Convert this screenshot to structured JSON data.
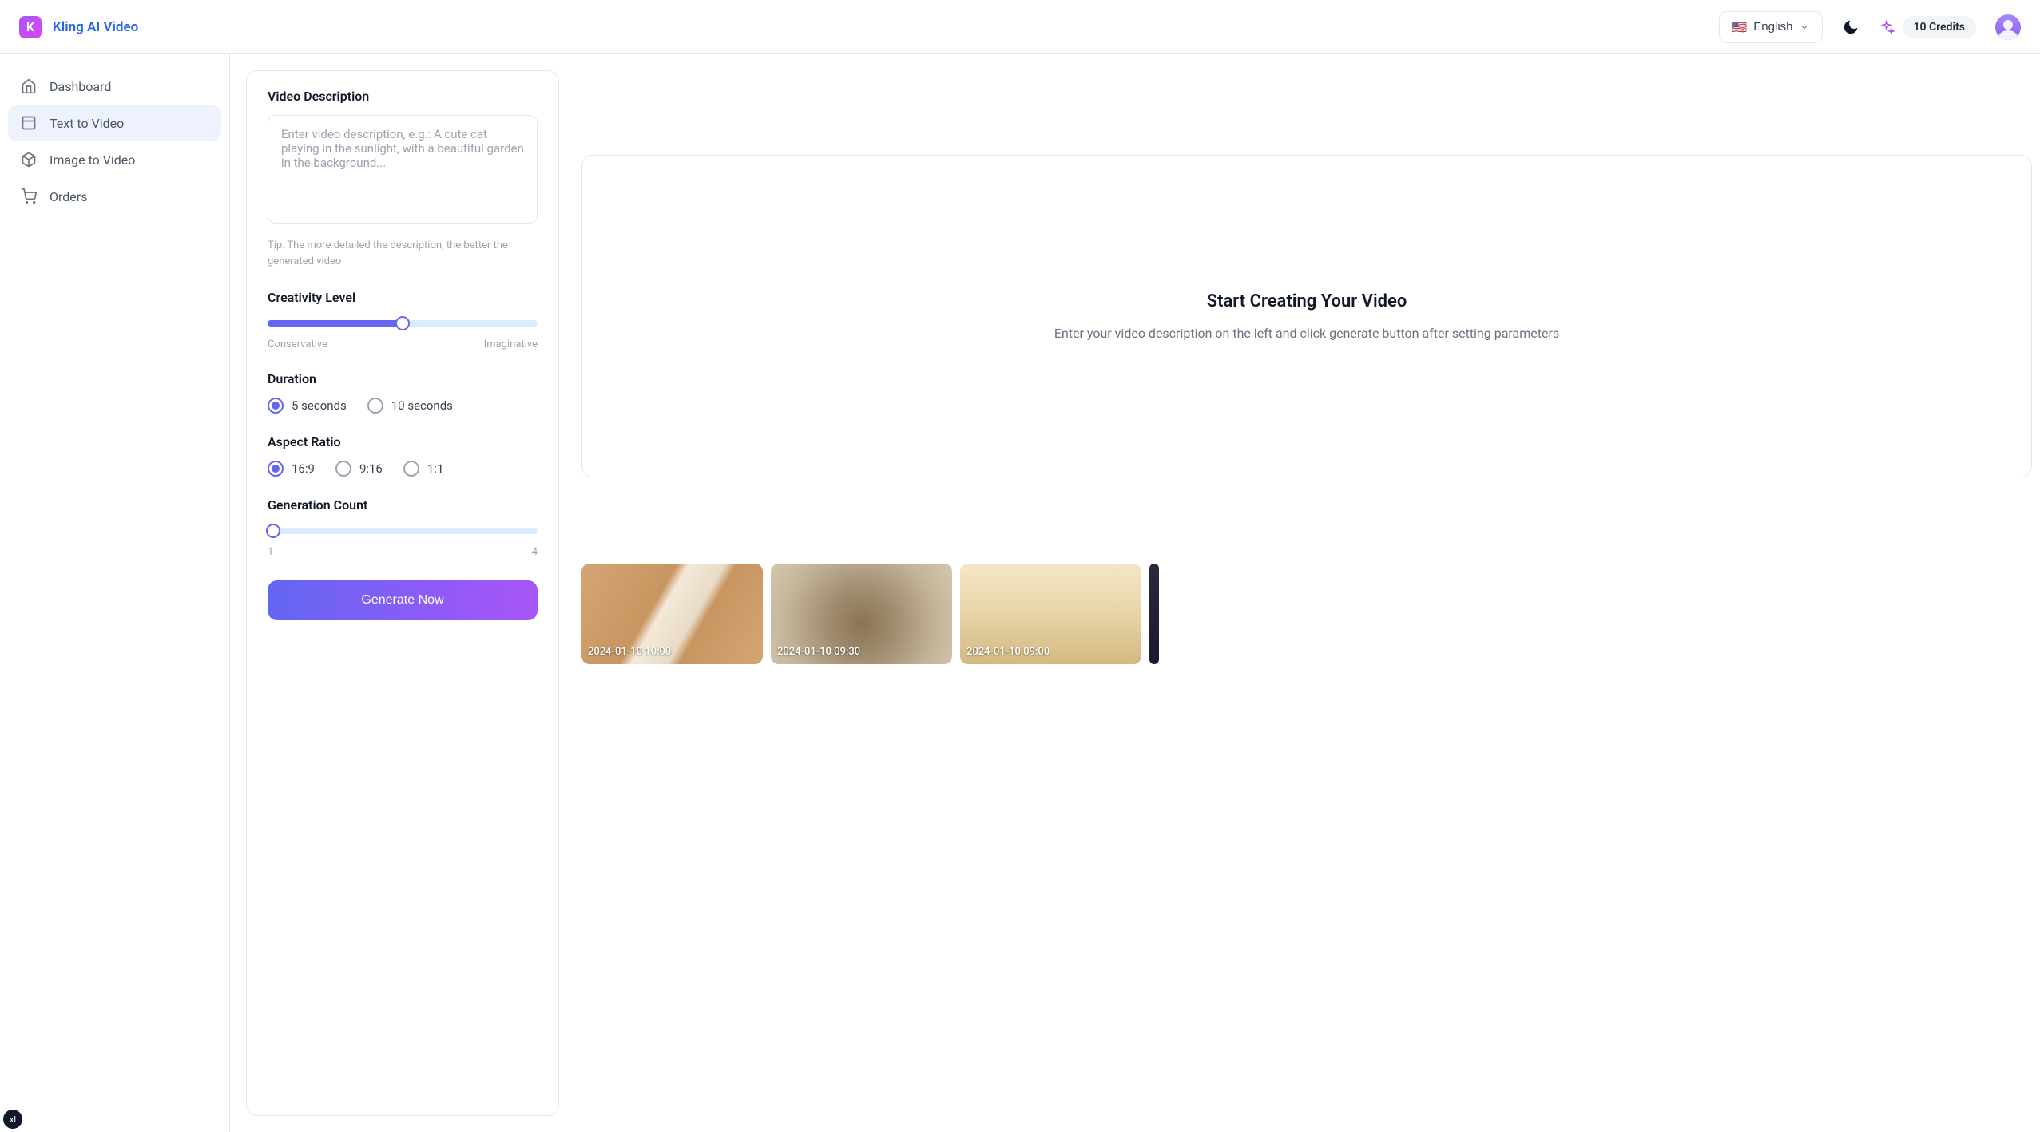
{
  "brand": {
    "logo_letter": "K",
    "name": "Kling AI Video"
  },
  "header": {
    "lang_flag": "🇺🇸",
    "lang_label": "English",
    "credits_label": "10 Credits"
  },
  "sidebar": {
    "items": [
      {
        "label": "Dashboard",
        "active": false
      },
      {
        "label": "Text to Video",
        "active": true
      },
      {
        "label": "Image to Video",
        "active": false
      },
      {
        "label": "Orders",
        "active": false
      }
    ]
  },
  "form": {
    "desc_label": "Video Description",
    "desc_placeholder": "Enter video description, e.g.: A cute cat playing in the sunlight, with a beautiful garden in the background...",
    "desc_value": "",
    "tip": "Tip: The more detailed the description, the better the generated video",
    "creativity_label": "Creativity Level",
    "creativity_min_label": "Conservative",
    "creativity_max_label": "Imaginative",
    "creativity_pct": 50,
    "duration_label": "Duration",
    "duration_options": [
      "5 seconds",
      "10 seconds"
    ],
    "duration_selected": 0,
    "aspect_label": "Aspect Ratio",
    "aspect_options": [
      "16:9",
      "9:16",
      "1:1"
    ],
    "aspect_selected": 0,
    "count_label": "Generation Count",
    "count_min": "1",
    "count_max": "4",
    "count_pct": 0,
    "generate_label": "Generate Now"
  },
  "preview": {
    "title": "Start Creating Your Video",
    "subtitle": "Enter your video description on the left and click generate button after setting parameters"
  },
  "thumbnails": [
    {
      "ts": "2024-01-10 10:00"
    },
    {
      "ts": "2024-01-10 09:30"
    },
    {
      "ts": "2024-01-10 09:00"
    }
  ],
  "badge": "xl"
}
